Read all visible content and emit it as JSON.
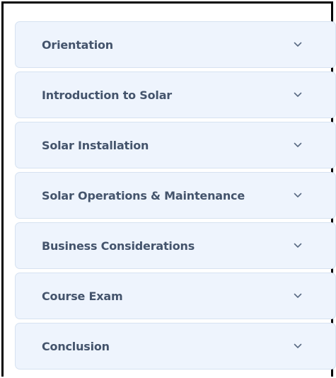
{
  "accordion": {
    "sections": [
      {
        "label": "Orientation"
      },
      {
        "label": "Introduction to Solar"
      },
      {
        "label": "Solar Installation"
      },
      {
        "label": "Solar Operations & Maintenance"
      },
      {
        "label": "Business Considerations"
      },
      {
        "label": "Course Exam"
      },
      {
        "label": "Conclusion"
      }
    ],
    "chevron_icon": "chevron-down-icon",
    "colors": {
      "section_bg": "#eef4fd",
      "section_border": "#d6e2f1",
      "label_text": "#44546c",
      "chevron": "#5a6b84"
    }
  }
}
